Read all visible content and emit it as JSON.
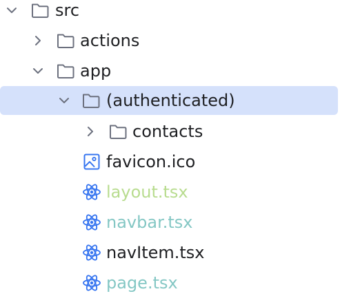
{
  "tree": {
    "items": [
      {
        "label": "src",
        "color": "#1e1f22"
      },
      {
        "label": "actions",
        "color": "#1e1f22"
      },
      {
        "label": "app",
        "color": "#1e1f22"
      },
      {
        "label": "(authenticated)",
        "color": "#1e1f22"
      },
      {
        "label": "contacts",
        "color": "#1e1f22"
      },
      {
        "label": "favicon.ico",
        "color": "#1e1f22"
      },
      {
        "label": "layout.tsx",
        "color": "#b8dc8f"
      },
      {
        "label": "navbar.tsx",
        "color": "#84c7c4"
      },
      {
        "label": "navItem.tsx",
        "color": "#1e1f22"
      },
      {
        "label": "page.tsx",
        "color": "#84c7c4"
      }
    ],
    "selected_label": "(authenticated)",
    "selection_color": "#d5e1fb",
    "icon_names": [
      "folder-icon",
      "image-file-icon",
      "react-file-icon"
    ],
    "chevron_names": [
      "chevron-down-icon",
      "chevron-right-icon"
    ]
  }
}
